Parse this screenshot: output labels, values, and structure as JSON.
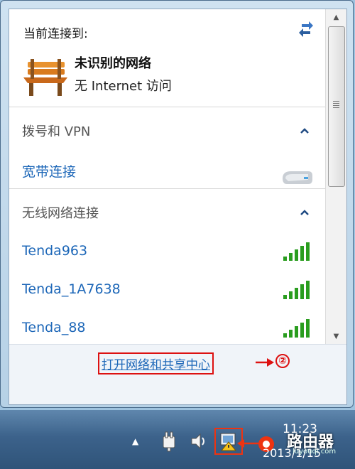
{
  "connection": {
    "title": "当前连接到:",
    "network_name": "未识别的网络",
    "network_status": "无 Internet 访问"
  },
  "sections": {
    "vpn": {
      "title": "拨号和 VPN",
      "items": [
        {
          "label": "宽带连接"
        }
      ]
    },
    "wireless": {
      "title": "无线网络连接",
      "items": [
        {
          "label": "Tenda963",
          "signal_bars": 5
        },
        {
          "label": "Tenda_1A7638",
          "signal_bars": 5
        },
        {
          "label": "Tenda_88",
          "signal_bars": 5
        }
      ]
    }
  },
  "footer": {
    "link_label": "打开网络和共享中心",
    "annotation_number": "②"
  },
  "taskbar": {
    "clock_time": "11:23",
    "clock_date": "2013/1/15"
  },
  "watermark": {
    "text": "路由器",
    "subtext": "luyouqi.com"
  },
  "icons": {
    "refresh": "refresh-arrows-icon",
    "network": "park-bench-icon",
    "broadband": "modem-icon",
    "signal": "wifi-signal-icon",
    "tray_power": "power-plug-icon",
    "tray_volume": "speaker-icon",
    "tray_network": "network-warning-icon"
  },
  "colors": {
    "link": "#1d67b8",
    "annotation": "#dd1111",
    "signal": "#2a9d1f",
    "taskbar": "#3c628b"
  }
}
